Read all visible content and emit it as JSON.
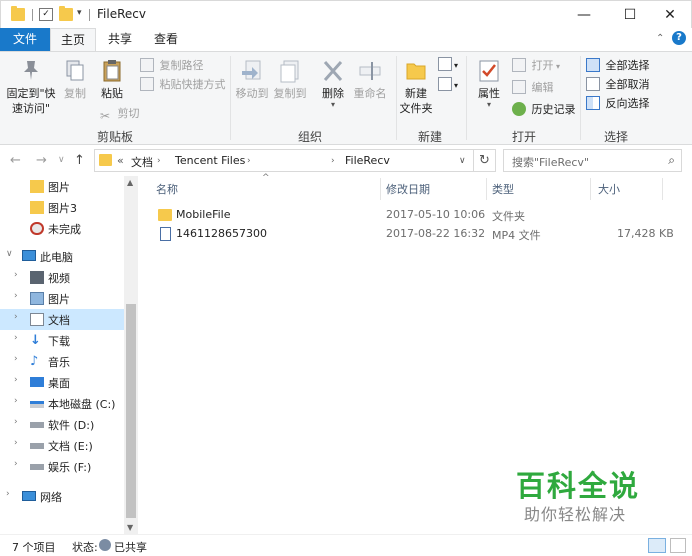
{
  "window": {
    "title": "FileRecv"
  },
  "window_controls": {
    "minimize": "—",
    "maximize": "☐",
    "close": "✕"
  },
  "ribbon_tabs": [
    "文件",
    "主页",
    "共享",
    "查看"
  ],
  "ribbon": {
    "pin_label": "固定到\"快\n速访问\"",
    "copy": "复制",
    "paste": "粘贴",
    "copy_path": "复制路径",
    "paste_shortcut": "粘贴快捷方式",
    "cut": "剪切",
    "clipboard_group": "剪贴板",
    "move_to": "移动到",
    "copy_to": "复制到",
    "delete": "删除",
    "rename": "重命名",
    "organize_group": "组织",
    "new_folder": "新建\n文件夹",
    "new_group": "新建",
    "properties": "属性",
    "open": "打开",
    "edit": "编辑",
    "history": "历史记录",
    "open_group": "打开",
    "select_all": "全部选择",
    "select_none": "全部取消",
    "invert_selection": "反向选择",
    "select_group": "选择"
  },
  "address": {
    "overflow": "«",
    "crumbs": [
      "文档",
      "Tencent Files",
      "FileRecv"
    ],
    "search_placeholder": "搜索\"FileRecv\""
  },
  "nav_pane": {
    "items": [
      {
        "label": "图片",
        "icon": "folder-icon"
      },
      {
        "label": "图片3",
        "icon": "folder-icon"
      },
      {
        "label": "未完成",
        "icon": "unfinished-icon"
      },
      {
        "label": "此电脑",
        "icon": "computer-icon"
      },
      {
        "label": "视频",
        "icon": "video-icon"
      },
      {
        "label": "图片",
        "icon": "pictures-icon"
      },
      {
        "label": "文档",
        "icon": "documents-icon"
      },
      {
        "label": "下载",
        "icon": "download-icon"
      },
      {
        "label": "音乐",
        "icon": "music-icon"
      },
      {
        "label": "桌面",
        "icon": "desktop-icon"
      },
      {
        "label": "本地磁盘 (C:)",
        "icon": "drive-icon"
      },
      {
        "label": "软件 (D:)",
        "icon": "drive-icon"
      },
      {
        "label": "文档 (E:)",
        "icon": "drive-icon"
      },
      {
        "label": "娱乐 (F:)",
        "icon": "drive-icon"
      },
      {
        "label": "网络",
        "icon": "network-icon"
      }
    ]
  },
  "file_list": {
    "columns": [
      "名称",
      "修改日期",
      "类型",
      "大小"
    ],
    "rows": [
      {
        "name": "MobileFile",
        "modified": "2017-05-10 10:06",
        "type": "文件夹",
        "size": "",
        "icon": "folder-icon"
      },
      {
        "name": "1461128657300",
        "modified": "2017-08-22 16:32",
        "type": "MP4 文件",
        "size": "17,428 KB",
        "icon": "video-file-icon"
      }
    ]
  },
  "status_bar": {
    "item_count": "7 个项目",
    "state_label": "状态:",
    "state_value": "已共享"
  },
  "watermark": {
    "title": "百科全说",
    "subtitle": "助你轻松解决"
  },
  "colors": {
    "accent": "#1979ca",
    "selection": "#cce8ff",
    "folder": "#f6c94c",
    "watermark_green": "#2fa93e"
  }
}
